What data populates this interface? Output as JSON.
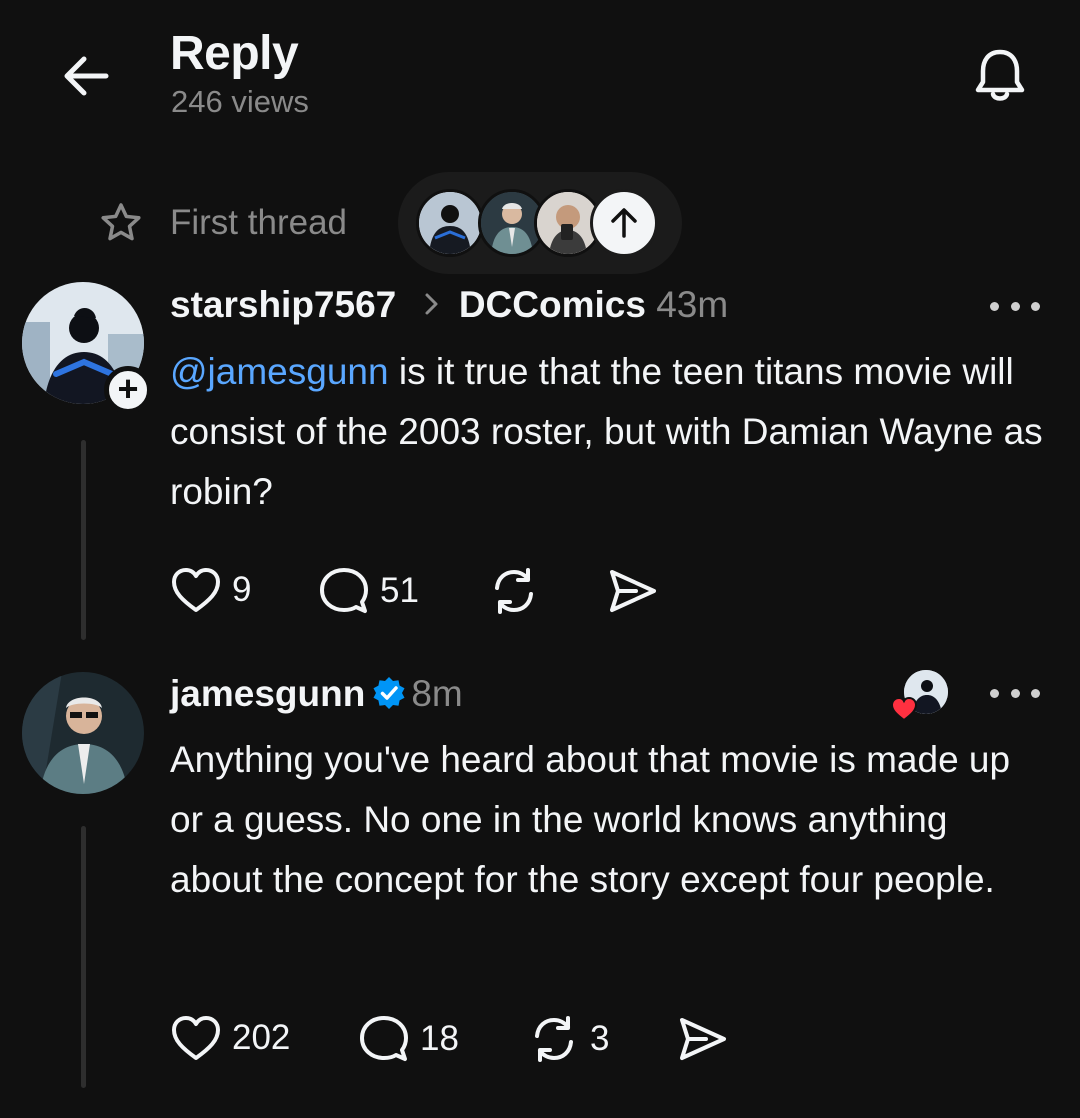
{
  "header": {
    "title": "Reply",
    "views": "246 views"
  },
  "thread_bar": {
    "label": "First thread"
  },
  "posts": [
    {
      "username": "starship7567",
      "community": "DCComics",
      "time": "43m",
      "mention": "@jamesgunn",
      "text": " is it true that the teen titans movie will consist of the 2003 roster, but with Damian Wayne as robin?",
      "likes": "9",
      "replies": "51",
      "reposts": ""
    },
    {
      "username": "jamesgunn",
      "verified": true,
      "time": "8m",
      "text": "Anything you've heard about that movie is made up or a guess. No one in the world knows anything about the concept for the story except four people.",
      "likes": "202",
      "replies": "18",
      "reposts": "3"
    }
  ],
  "colors": {
    "background": "#101010",
    "text": "#f3f5f7",
    "secondary": "#8a8a8a",
    "mention": "#5aa7ff",
    "verified": "#0095f6",
    "like_heart": "#ff3040"
  },
  "icons": [
    "back-arrow-icon",
    "bell-icon",
    "star-icon",
    "arrow-up-icon",
    "heart-icon",
    "comment-icon",
    "repost-icon",
    "share-icon",
    "more-icon",
    "verified-icon",
    "plus-icon"
  ]
}
